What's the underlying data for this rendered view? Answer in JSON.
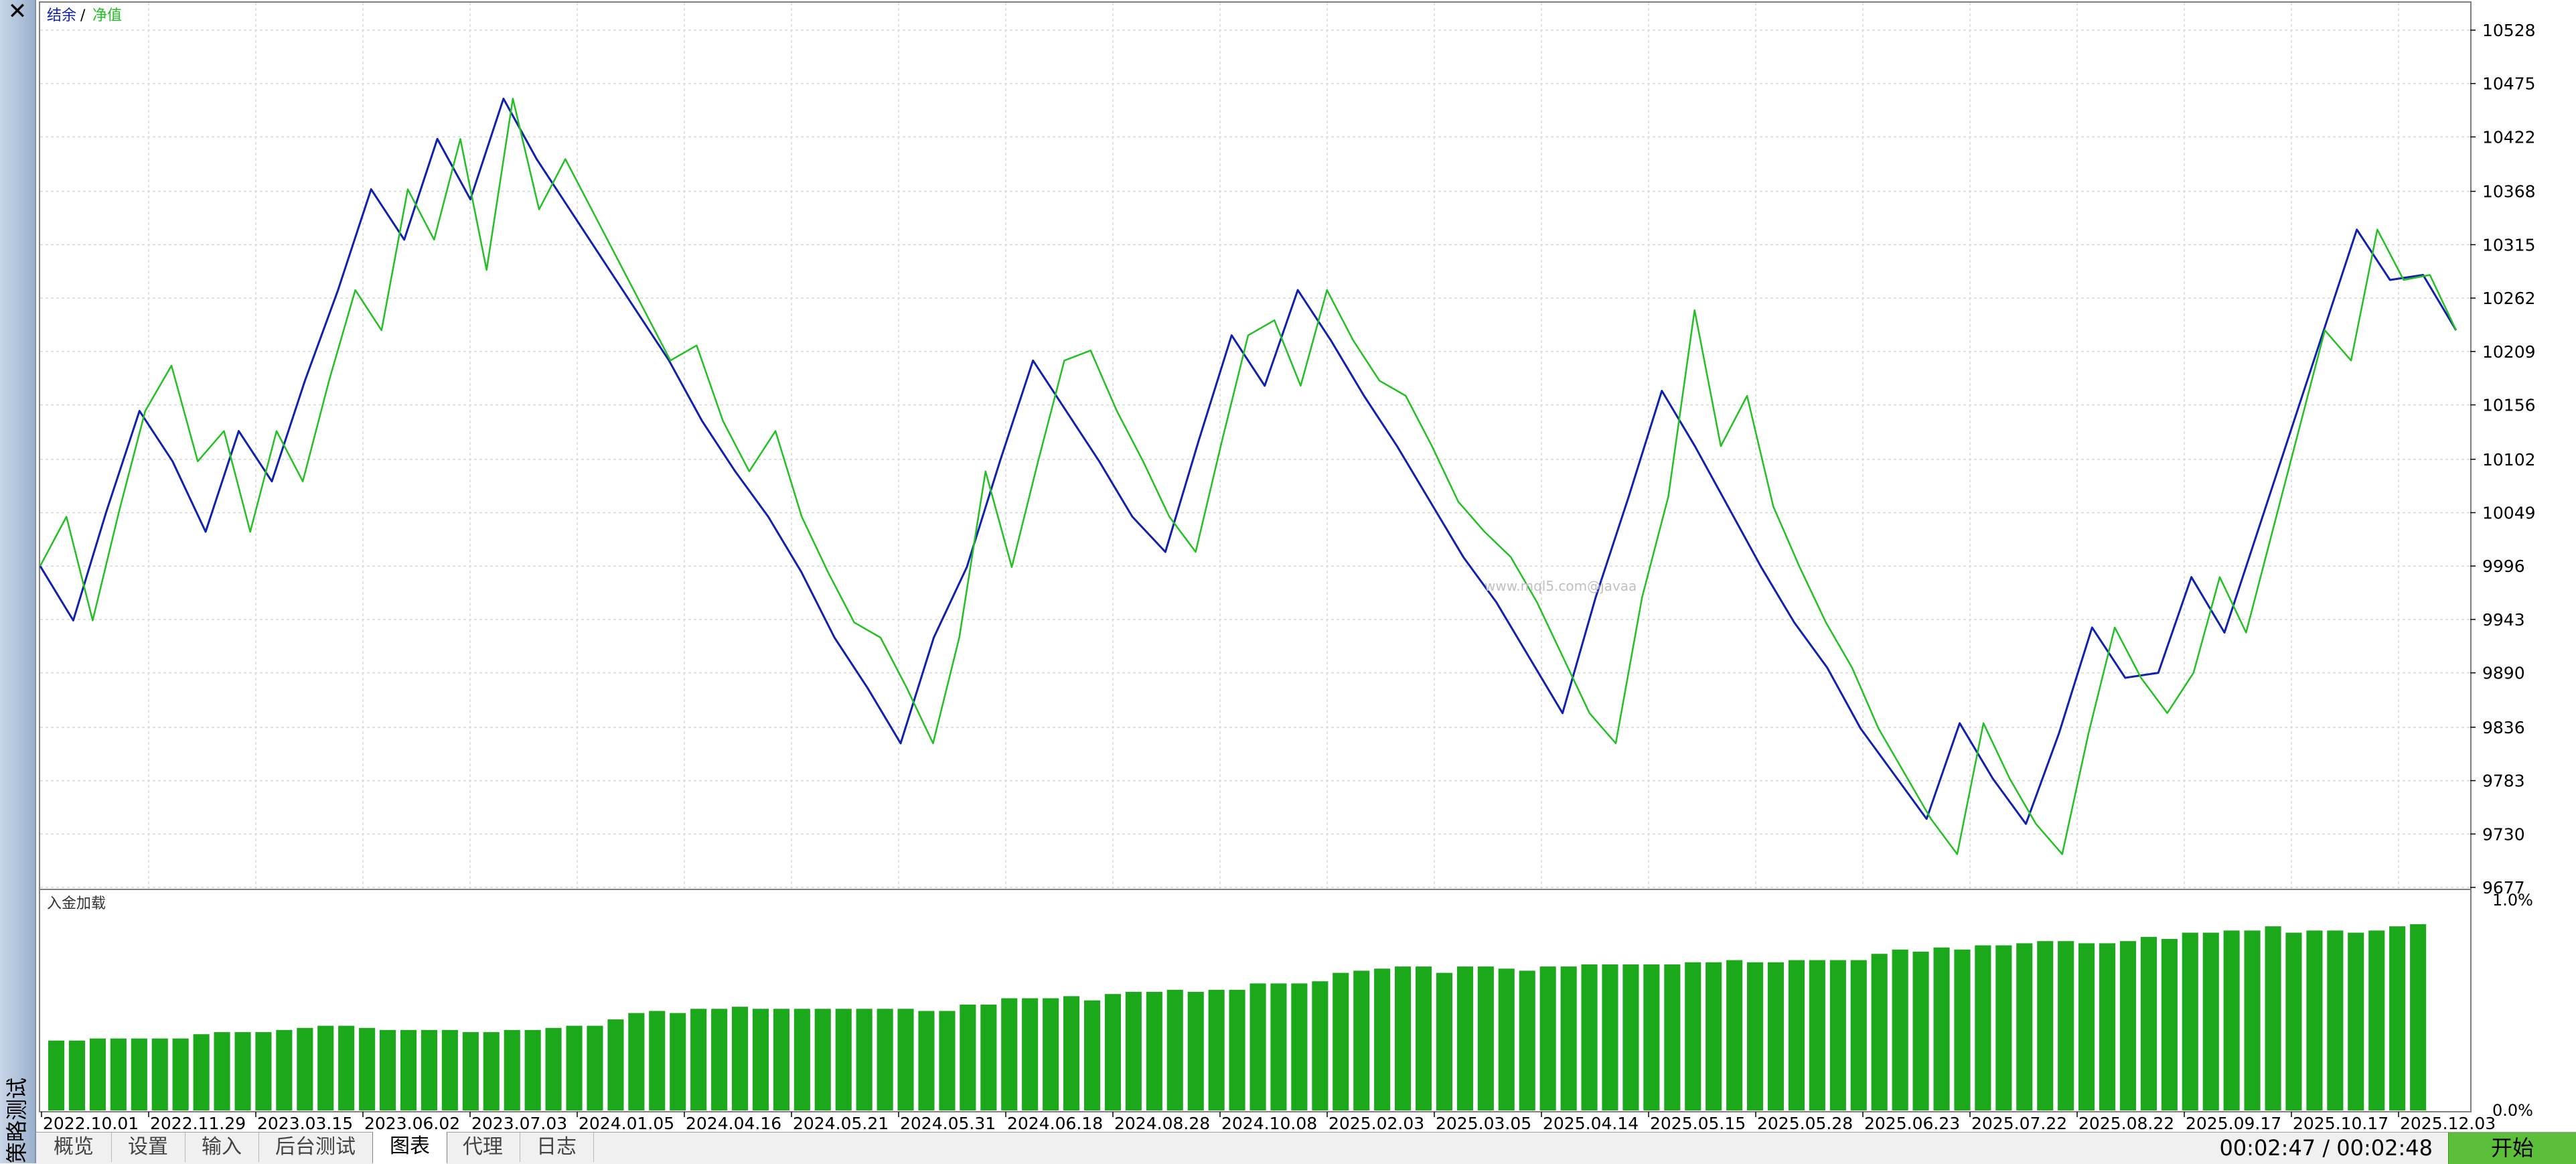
{
  "sidebar": {
    "title": "策略测试",
    "close_icon": "close-icon"
  },
  "legend": {
    "balance": "结余",
    "separator": "/",
    "equity": "净值"
  },
  "colors": {
    "balance": "#1020b0",
    "equity": "#22c022",
    "bars": "#1ba81b",
    "grid": "#d8d8d8"
  },
  "watermark": "www.mql5.com@javaa",
  "subpanel": {
    "title": "入金加载",
    "top_label": "1.0%",
    "bottom_label": "0.0%"
  },
  "chart_data": [
    {
      "type": "line",
      "x_tick_labels": [
        "2022.10.01",
        "2022.11.29",
        "2023.03.15",
        "2023.06.02",
        "2023.07.03",
        "2024.01.05",
        "2024.04.16",
        "2024.05.21",
        "2024.05.31",
        "2024.06.18",
        "2024.08.28",
        "2024.10.08",
        "2025.02.03",
        "2025.03.05",
        "2025.04.14",
        "2025.05.15",
        "2025.05.28",
        "2025.06.23",
        "2025.07.22",
        "2025.08.22",
        "2025.09.17",
        "2025.10.17",
        "2025.12.03"
      ],
      "y_tick_labels": [
        "10528",
        "10475",
        "10422",
        "10368",
        "10315",
        "10262",
        "10209",
        "10156",
        "10102",
        "10049",
        "9996",
        "9943",
        "9890",
        "9836",
        "9783",
        "9730",
        "9677"
      ],
      "ylim": [
        9677,
        10528
      ],
      "series": [
        {
          "name": "结余",
          "values": [
            9996,
            9942,
            10050,
            10150,
            10100,
            10030,
            10130,
            10080,
            10180,
            10270,
            10370,
            10320,
            10420,
            10360,
            10460,
            10400,
            10350,
            10300,
            10250,
            10200,
            10140,
            10090,
            10045,
            9990,
            9925,
            9875,
            9820,
            9925,
            9995,
            10100,
            10200,
            10150,
            10100,
            10045,
            10010,
            10120,
            10225,
            10175,
            10270,
            10220,
            10165,
            10115,
            10060,
            10005,
            9960,
            9905,
            9850,
            9965,
            10065,
            10170,
            10115,
            10055,
            9995,
            9940,
            9895,
            9835,
            9790,
            9745,
            9840,
            9785,
            9740,
            9830,
            9935,
            9885,
            9890,
            9985,
            9930,
            10030,
            10130,
            10230,
            10330,
            10280,
            10285,
            10230
          ]
        },
        {
          "name": "净值",
          "values": [
            9996,
            10045,
            9942,
            10050,
            10150,
            10195,
            10100,
            10130,
            10030,
            10130,
            10080,
            10180,
            10270,
            10230,
            10370,
            10320,
            10420,
            10290,
            10460,
            10350,
            10400,
            10350,
            10300,
            10250,
            10200,
            10215,
            10140,
            10090,
            10130,
            10045,
            9990,
            9940,
            9925,
            9875,
            9820,
            9925,
            10090,
            9995,
            10100,
            10200,
            10210,
            10150,
            10100,
            10045,
            10010,
            10120,
            10225,
            10240,
            10175,
            10270,
            10220,
            10180,
            10165,
            10115,
            10060,
            10030,
            10005,
            9960,
            9905,
            9850,
            9820,
            9965,
            10065,
            10250,
            10115,
            10165,
            10055,
            9995,
            9940,
            9895,
            9835,
            9790,
            9745,
            9710,
            9840,
            9785,
            9740,
            9710,
            9830,
            9935,
            9885,
            9850,
            9890,
            9985,
            9930,
            10030,
            10130,
            10230,
            10200,
            10330,
            10280,
            10285,
            10230
          ]
        }
      ],
      "grid": true
    },
    {
      "type": "bar",
      "title": "入金加载",
      "ylim": [
        0,
        1.0
      ],
      "values": [
        0.33,
        0.33,
        0.34,
        0.34,
        0.34,
        0.34,
        0.34,
        0.36,
        0.37,
        0.37,
        0.37,
        0.38,
        0.39,
        0.4,
        0.4,
        0.39,
        0.38,
        0.38,
        0.38,
        0.38,
        0.37,
        0.37,
        0.38,
        0.38,
        0.39,
        0.4,
        0.4,
        0.43,
        0.46,
        0.47,
        0.46,
        0.48,
        0.48,
        0.49,
        0.48,
        0.48,
        0.48,
        0.48,
        0.48,
        0.48,
        0.48,
        0.48,
        0.47,
        0.47,
        0.5,
        0.5,
        0.53,
        0.53,
        0.53,
        0.54,
        0.52,
        0.55,
        0.56,
        0.56,
        0.57,
        0.56,
        0.57,
        0.57,
        0.6,
        0.6,
        0.6,
        0.61,
        0.65,
        0.66,
        0.67,
        0.68,
        0.68,
        0.65,
        0.68,
        0.68,
        0.67,
        0.66,
        0.68,
        0.68,
        0.69,
        0.69,
        0.69,
        0.69,
        0.69,
        0.7,
        0.7,
        0.71,
        0.7,
        0.7,
        0.71,
        0.71,
        0.71,
        0.71,
        0.74,
        0.76,
        0.75,
        0.77,
        0.76,
        0.78,
        0.78,
        0.79,
        0.8,
        0.8,
        0.79,
        0.79,
        0.8,
        0.82,
        0.81,
        0.84,
        0.84,
        0.85,
        0.85,
        0.87,
        0.84,
        0.85,
        0.85,
        0.84,
        0.85,
        0.87,
        0.88
      ],
      "grid": false
    }
  ],
  "tabs": [
    {
      "label": "概览",
      "name": "tab-overview",
      "active": false
    },
    {
      "label": "设置",
      "name": "tab-settings",
      "active": false
    },
    {
      "label": "输入",
      "name": "tab-inputs",
      "active": false
    },
    {
      "label": "后台测试",
      "name": "tab-backtest",
      "active": false
    },
    {
      "label": "图表",
      "name": "tab-graph",
      "active": true
    },
    {
      "label": "代理",
      "name": "tab-agents",
      "active": false
    },
    {
      "label": "日志",
      "name": "tab-journal",
      "active": false
    }
  ],
  "status": {
    "timer": "00:02:47 / 00:02:48",
    "start_label": "开始"
  }
}
